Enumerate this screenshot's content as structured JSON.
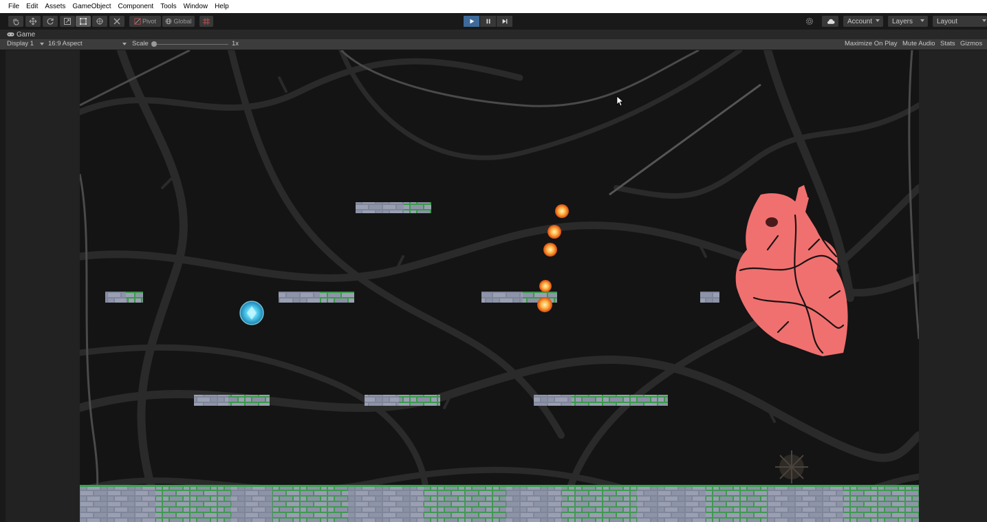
{
  "menu": [
    "File",
    "Edit",
    "Assets",
    "GameObject",
    "Component",
    "Tools",
    "Window",
    "Help"
  ],
  "toolbar": {
    "tools": [
      "hand-icon",
      "move-icon",
      "rotate-icon",
      "scale-icon",
      "rect-icon",
      "transform-icon",
      "custom-tool-icon"
    ],
    "pivot_label": "Pivot",
    "global_label": "Global",
    "account_label": "Account",
    "layers_label": "Layers",
    "layout_label": "Layout"
  },
  "tab": {
    "label": "Game"
  },
  "gamebar": {
    "display": "Display 1",
    "aspect": "16:9 Aspect",
    "scale_label": "Scale",
    "scale_value": "1x",
    "maximize": "Maximize On Play",
    "mute": "Mute Audio",
    "stats": "Stats",
    "gizmos": "Gizmos"
  },
  "colors": {
    "play_active": "#3e6a9a",
    "heart": "#f07070",
    "orb": "#55d0f0",
    "fire": "#ff9a30",
    "stone": "#8c92a4",
    "moss": "#3aa050"
  }
}
